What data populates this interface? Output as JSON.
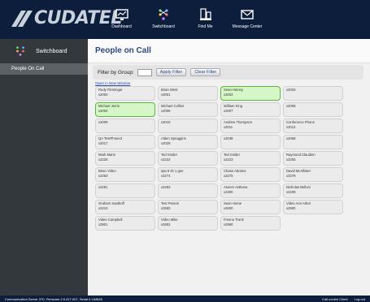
{
  "header": {
    "brand": "CUDATEL",
    "nav": [
      {
        "label": "Dashboard",
        "icon": "dashboard-icon"
      },
      {
        "label": "Switchboard",
        "icon": "switchboard-icon"
      },
      {
        "label": "Find Me",
        "icon": "find-me-icon"
      },
      {
        "label": "Message Center",
        "icon": "message-center-icon"
      }
    ]
  },
  "sidebar": {
    "title": "Switchboard",
    "items": [
      {
        "label": "People On Call"
      }
    ]
  },
  "main": {
    "title": "People on Call",
    "filter": {
      "label": "Filter by Group:",
      "value": "",
      "apply_label": "Apply Filter",
      "clear_label": "Clear Filter"
    },
    "open_link": "Open in New Window",
    "cards": [
      {
        "name": "Rudy Flemingar",
        "ext": "x2000",
        "active": false
      },
      {
        "name": "Brian West",
        "ext": "x2001",
        "active": false
      },
      {
        "name": "Sean Heiney",
        "ext": "x2002",
        "active": true
      },
      {
        "name": "",
        "ext": "x2003",
        "active": false
      },
      {
        "name": "Michael Jerris",
        "ext": "x2004",
        "active": true
      },
      {
        "name": "Michael Collins",
        "ext": "x2006",
        "active": false
      },
      {
        "name": "William King",
        "ext": "x2007",
        "active": false
      },
      {
        "name": "",
        "ext": "x2008",
        "active": false
      },
      {
        "name": "",
        "ext": "x2009",
        "active": false
      },
      {
        "name": "",
        "ext": "x2010",
        "active": false
      },
      {
        "name": "Andrew Thompson",
        "ext": "x2011",
        "active": false
      },
      {
        "name": "Conference Phone",
        "ext": "x2012",
        "active": false
      },
      {
        "name": "QA TestPhone3",
        "ext": "x2017",
        "active": false
      },
      {
        "name": "Alden Spraggins",
        "ext": "x2029",
        "active": false
      },
      {
        "name": "",
        "ext": "x2038",
        "active": false
      },
      {
        "name": "",
        "ext": "x2068",
        "active": false
      },
      {
        "name": "Mark Mann",
        "ext": "x2220",
        "active": false
      },
      {
        "name": "Ted Snider",
        "ext": "x2222",
        "active": false
      },
      {
        "name": "Ted Snider",
        "ext": "x2223",
        "active": false
      },
      {
        "name": "Raymond Claudien",
        "ext": "x2255",
        "active": false
      },
      {
        "name": "Brian Video",
        "ext": "x2263",
        "active": false
      },
      {
        "name": "spa 5 sh 1 gee",
        "ext": "x2274",
        "active": false
      },
      {
        "name": "Chase Abrams",
        "ext": "x2275",
        "active": false
      },
      {
        "name": "David McAllister",
        "ext": "x2278",
        "active": false
      },
      {
        "name": "",
        "ext": "x2281",
        "active": false
      },
      {
        "name": "",
        "ext": "x2283",
        "active": false
      },
      {
        "name": "Aseem Asthana",
        "ext": "x2300",
        "active": false
      },
      {
        "name": "Nicholas Belluni",
        "ext": "x2409",
        "active": false
      },
      {
        "name": "Graham Saathoff",
        "ext": "x2410",
        "active": false
      },
      {
        "name": "Test Person",
        "ext": "x2580",
        "active": false
      },
      {
        "name": "Sean Home",
        "ext": "x2600",
        "active": false
      },
      {
        "name": "Video Ann Arbor",
        "ext": "x2900",
        "active": false
      },
      {
        "name": "Video Campbell",
        "ext": "x2901",
        "active": false
      },
      {
        "name": "Video Mike",
        "ext": "x2902",
        "active": false
      },
      {
        "name": "Fresno Trunk",
        "ext": "x2990",
        "active": false
      }
    ]
  },
  "footer": {
    "status": "Communication Server 370, Firmware 2.0.017.007, Serial # 184845",
    "client_link": "Call-control Client",
    "logout": "Log out"
  },
  "colors": {
    "header_bg": "#0c1e3c",
    "sidebar_bg": "#33383c",
    "active_card": "#d5f6c6",
    "active_border": "#62b241"
  }
}
